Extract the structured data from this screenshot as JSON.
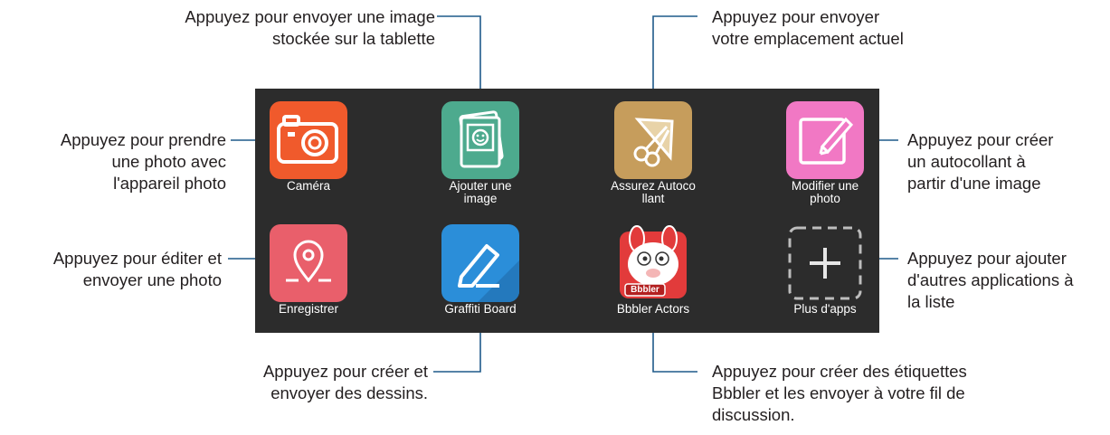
{
  "apps": [
    {
      "label_lines": [
        "Caméra"
      ],
      "icon": "camera-icon",
      "color": "#f05a2c"
    },
    {
      "label_lines": [
        "Ajouter une",
        "image"
      ],
      "icon": "photo-stack-icon",
      "color": "#4daa8e"
    },
    {
      "label_lines": [
        "Assurez Autoco",
        "llant"
      ],
      "icon": "scissors-sticker-icon",
      "color": "#c69d5c"
    },
    {
      "label_lines": [
        "Modifier une",
        "photo"
      ],
      "icon": "edit-pencil-icon",
      "color": "#f178c4"
    },
    {
      "label_lines": [
        "Enregistrer"
      ],
      "icon": "location-pin-icon",
      "color": "#e95f6b"
    },
    {
      "label_lines": [
        "Graffiti Board"
      ],
      "icon": "marker-pen-icon",
      "color": "#2b8ed9"
    },
    {
      "label_lines": [
        "Bbbler Actors"
      ],
      "icon": "bbbler-rabbit-icon",
      "badge_text": "Bbbler",
      "color": "#e23b3b"
    },
    {
      "label_lines": [
        "Plus d'apps"
      ],
      "icon": "plus-icon",
      "color": "#b5b5b5"
    }
  ],
  "callouts": {
    "top_left": [
      "Appuyez pour envoyer une image",
      "stockée sur la tablette"
    ],
    "top_right": [
      "Appuyez pour envoyer",
      "votre emplacement actuel"
    ],
    "left_1": [
      "Appuyez pour prendre",
      "une photo avec",
      "l'appareil photo"
    ],
    "left_2": [
      "Appuyez pour éditer et",
      "envoyer une photo"
    ],
    "right_1": [
      "Appuyez pour créer",
      "un autocollant à",
      "partir d'une image"
    ],
    "right_2": [
      "Appuyez pour ajouter",
      "d'autres applications à",
      "la liste"
    ],
    "bottom_left": [
      "Appuyez pour créer et",
      "envoyer des dessins."
    ],
    "bottom_right": [
      "Appuyez pour créer des étiquettes",
      "Bbbler et les envoyer à votre fil de",
      "discussion."
    ]
  },
  "colors": {
    "panel": "#2c2c2c",
    "leader_line": "#1f5a8a",
    "callout_text": "#231f20"
  }
}
